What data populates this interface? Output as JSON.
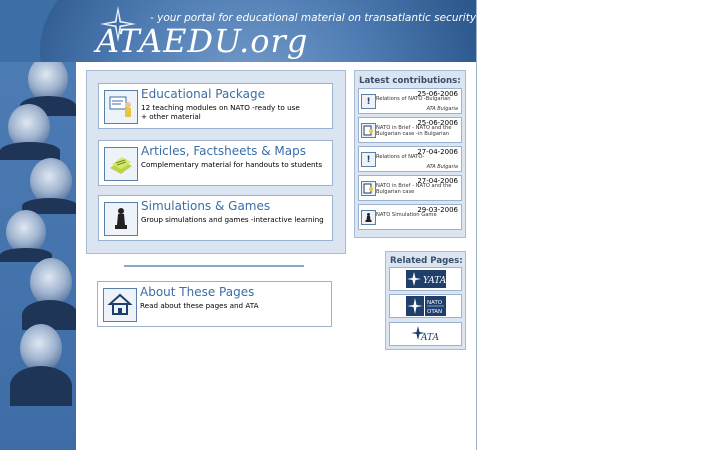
{
  "header": {
    "logo_text": "ATAEDU.org",
    "tagline": "- your portal for educational material on transatlantic security issues"
  },
  "modules": [
    {
      "title": "Educational Package",
      "desc_line1": "12 teaching modules on NATO -ready to use",
      "desc_line2": "+ other material",
      "icon": "teacher-board-icon"
    },
    {
      "title": "Articles, Factsheets & Maps",
      "desc_line1": "Complementary material for handouts to students",
      "desc_line2": "",
      "icon": "documents-icon"
    },
    {
      "title": "Simulations & Games",
      "desc_line1": "Group simulations and games -interactive learning",
      "desc_line2": "",
      "icon": "chess-piece-icon"
    }
  ],
  "about": {
    "title": "About These Pages",
    "desc": "Read about these pages and ATA",
    "icon": "house-icon"
  },
  "latest": {
    "title": "Latest contributions:",
    "items": [
      {
        "date": "25-06-2006",
        "text": "Relations of NATO -Bulgarian",
        "note": "ATA Bulgaria",
        "icon": "exclamation-icon",
        "glyph": "!"
      },
      {
        "date": "25-06-2006",
        "text": "NATO in Brief - NATO and the Bulgarian case -in Bulgarian",
        "note": "",
        "icon": "document-person-icon",
        "glyph": ""
      },
      {
        "date": "27-04-2006",
        "text": "Relations of NATO-",
        "note": "ATA Bulgaria",
        "icon": "exclamation-icon",
        "glyph": "!"
      },
      {
        "date": "27-04-2006",
        "text": "NATO in Brief - NATO and the Bulgarian case",
        "note": "",
        "icon": "document-person-icon",
        "glyph": ""
      },
      {
        "date": "29-03-2006",
        "text": "NATO Simulation Game",
        "note": "",
        "icon": "chess-piece-icon",
        "glyph": ""
      }
    ]
  },
  "related": {
    "title": "Related Pages:",
    "items": [
      {
        "name": "yata-logo",
        "label": "YATA"
      },
      {
        "name": "nato-otan-logo",
        "label_top": "NATO",
        "label_bottom": "OTAN"
      },
      {
        "name": "ata-logo",
        "label": "ATA"
      }
    ]
  },
  "colors": {
    "banner": "#3d6ea6",
    "panel": "#dbe5f2",
    "title_blue": "#3a6ea8",
    "navy": "#1e3f6b"
  }
}
